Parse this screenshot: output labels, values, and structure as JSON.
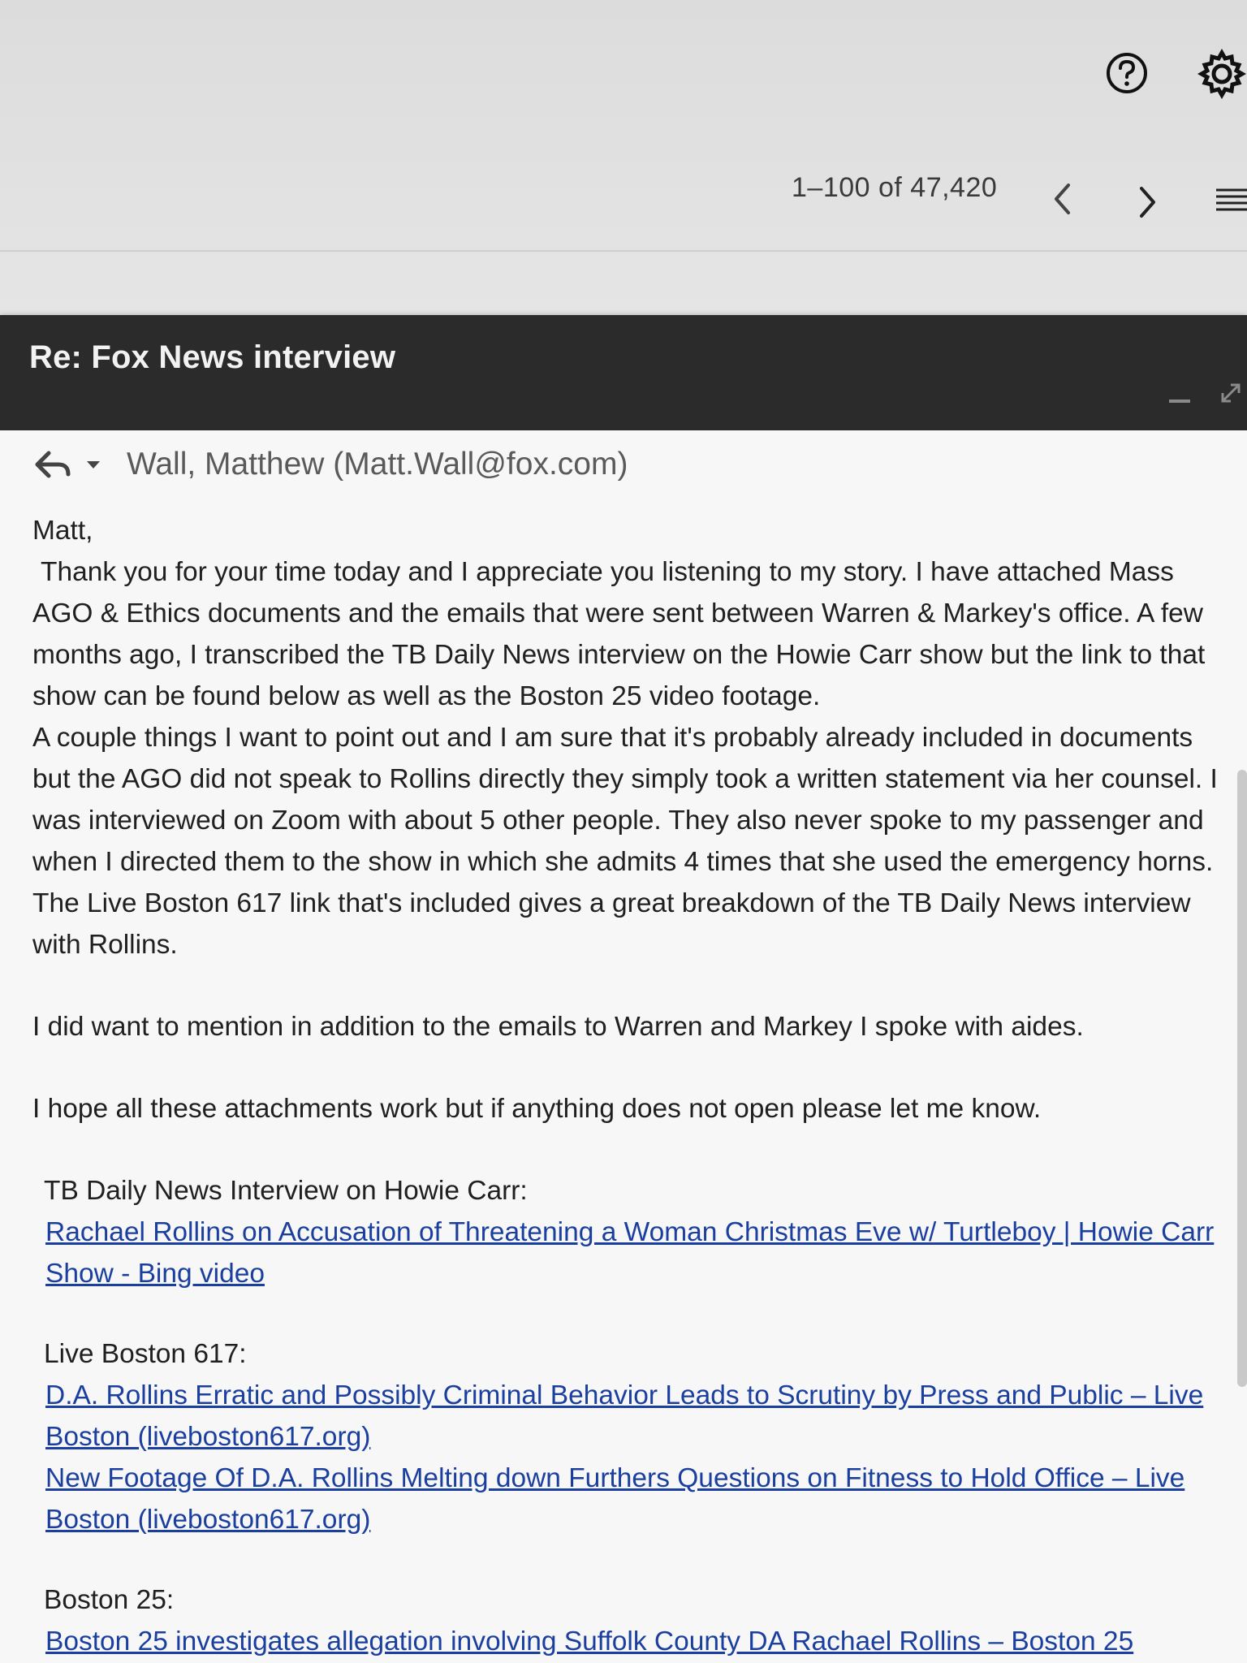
{
  "toolbar": {
    "help_icon": "help-circle-icon",
    "settings_icon": "gear-icon",
    "pager_text": "1–100 of 47,420",
    "prev_icon": "chevron-left-icon",
    "next_icon": "chevron-right-icon",
    "density_icon": "density-lines-icon"
  },
  "compose": {
    "title": "Re: Fox News interview",
    "minimize_icon": "minimize-icon",
    "expand_icon": "expand-icon",
    "reply_icon": "reply-icon",
    "dropdown_icon": "caret-down-icon",
    "recipient": "Wall, Matthew (Matt.Wall@fox.com)",
    "greeting": "Matt,",
    "paragraph1": "Thank you for your time today and I appreciate you listening to my story. I have attached Mass AGO & Ethics documents and the emails that were sent between Warren & Markey's office. A few months ago, I transcribed the TB Daily News interview on the Howie Carr show but the link to that show can be found below as well as the Boston 25 video footage.",
    "paragraph2": "A couple things I want to point out and I am sure that it's probably already included in documents but the AGO did not speak to Rollins directly they simply took a written statement via her counsel. I was interviewed on Zoom with about 5 other people. They also never spoke to my passenger and when I directed them to the show in which she admits 4 times that she used the emergency horns. The Live Boston 617 link that's included gives a great breakdown of the TB Daily News interview with Rollins.",
    "paragraph3": "I did want to mention in addition to the emails to Warren and Markey I spoke with aides.",
    "paragraph4": "I hope all these attachments work but if anything does not open please let me know.",
    "section1_label": "TB Daily News Interview on Howie Carr:",
    "section1_link": "Rachael Rollins on Accusation of Threatening a Woman Christmas Eve w/ Turtleboy | Howie Carr Show - Bing video",
    "section2_label": "Live Boston 617:",
    "section2_link1": "D.A. Rollins Erratic and Possibly Criminal Behavior Leads to Scrutiny by Press and Public – Live Boston (liveboston617.org)",
    "section2_link2": "New Footage Of D.A. Rollins Melting down Furthers Questions on Fitness to Hold Office – Live Boston (liveboston617.org)",
    "section3_label": "Boston 25:",
    "section3_link": "Boston 25 investigates allegation involving Suffolk County DA Rachael Rollins – Boston 25"
  }
}
